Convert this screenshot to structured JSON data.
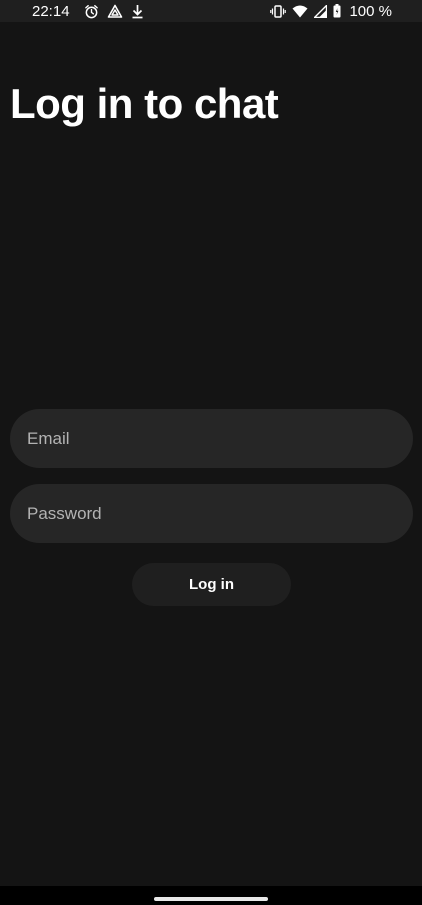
{
  "status_bar": {
    "time": "22:14",
    "battery": "100 %",
    "icons_left": [
      "alarm-icon",
      "vpn-triangle-icon",
      "download-icon"
    ],
    "icons_right": [
      "vibrate-icon",
      "wifi-icon",
      "signal-icon",
      "battery-icon"
    ]
  },
  "login": {
    "title": "Log in to chat",
    "email_placeholder": "Email",
    "email_value": "",
    "password_placeholder": "Password",
    "password_value": "",
    "button_label": "Log in"
  },
  "colors": {
    "background": "#141414",
    "field_background": "#262626",
    "button_background": "#1f1f1f",
    "text": "#ffffff",
    "placeholder": "#b3b3b3"
  }
}
